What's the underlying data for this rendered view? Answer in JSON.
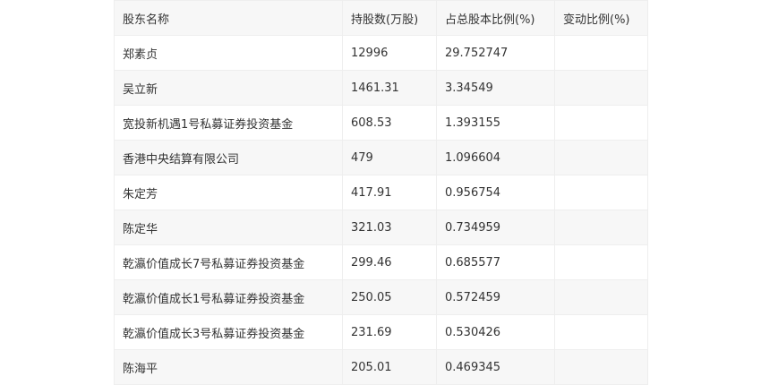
{
  "table": {
    "headers": [
      "股东名称",
      "持股数(万股)",
      "占总股本比例(%)",
      "变动比例(%)"
    ],
    "rows": [
      {
        "name": "郑素贞",
        "shares": "12996",
        "ratio": "29.752747",
        "change": ""
      },
      {
        "name": "吴立新",
        "shares": "1461.31",
        "ratio": "3.34549",
        "change": ""
      },
      {
        "name": "宽投新机遇1号私募证券投资基金",
        "shares": "608.53",
        "ratio": "1.393155",
        "change": ""
      },
      {
        "name": "香港中央结算有限公司",
        "shares": "479",
        "ratio": "1.096604",
        "change": ""
      },
      {
        "name": "朱定芳",
        "shares": "417.91",
        "ratio": "0.956754",
        "change": ""
      },
      {
        "name": "陈定华",
        "shares": "321.03",
        "ratio": "0.734959",
        "change": ""
      },
      {
        "name": "乾瀛价值成长7号私募证券投资基金",
        "shares": "299.46",
        "ratio": "0.685577",
        "change": ""
      },
      {
        "name": "乾瀛价值成长1号私募证券投资基金",
        "shares": "250.05",
        "ratio": "0.572459",
        "change": ""
      },
      {
        "name": "乾瀛价值成长3号私募证券投资基金",
        "shares": "231.69",
        "ratio": "0.530426",
        "change": ""
      },
      {
        "name": "陈海平",
        "shares": "205.01",
        "ratio": "0.469345",
        "change": ""
      }
    ]
  }
}
